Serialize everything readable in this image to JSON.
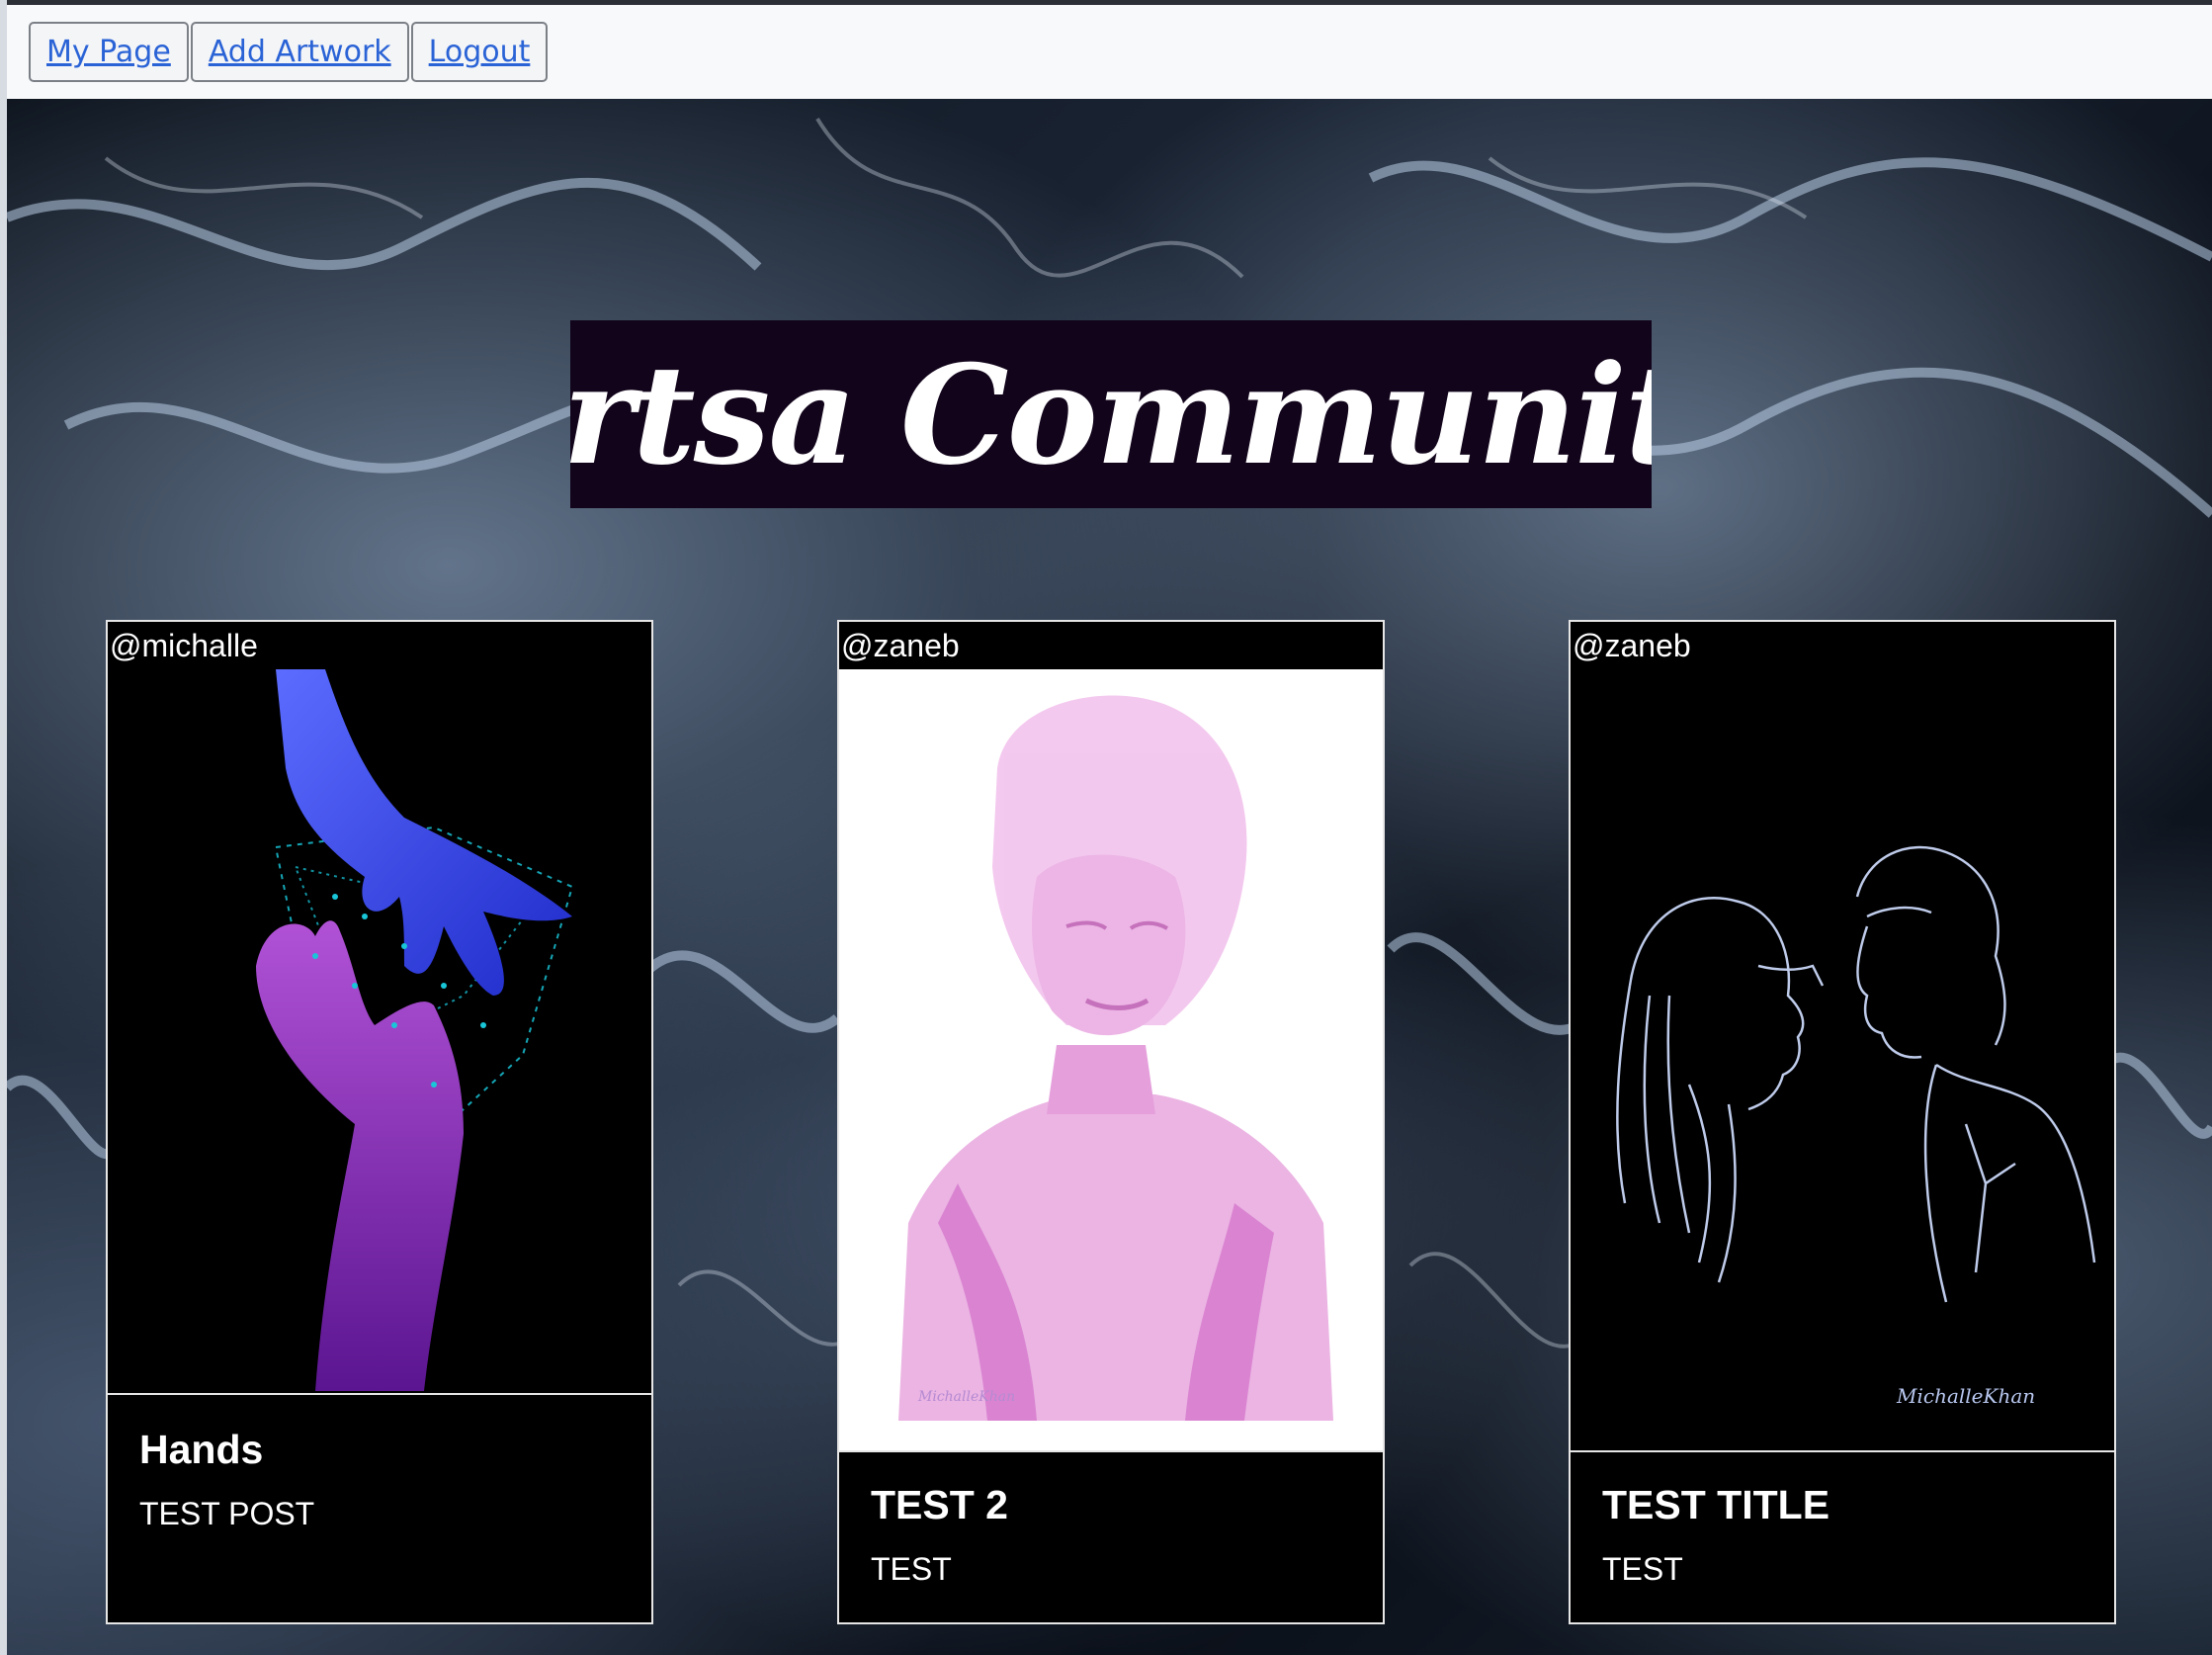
{
  "nav": {
    "my_page": "My Page",
    "add_artwork": "Add Artwork",
    "logout": "Logout"
  },
  "site": {
    "title": "Artsa Community"
  },
  "posts": [
    {
      "user": "@michalle",
      "title": "Hands",
      "text": "TEST POST"
    },
    {
      "user": "@zaneb",
      "title": "TEST 2",
      "text": "TEST",
      "signature": "MichalleKhan"
    },
    {
      "user": "@zaneb",
      "title": "TEST TITLE",
      "text": "TEST",
      "signature": "MichalleKhan"
    }
  ],
  "colors": {
    "nav_background": "#f8f9fa",
    "link": "#2a63d6",
    "title_background": "#12041b",
    "card_background": "#000000"
  }
}
